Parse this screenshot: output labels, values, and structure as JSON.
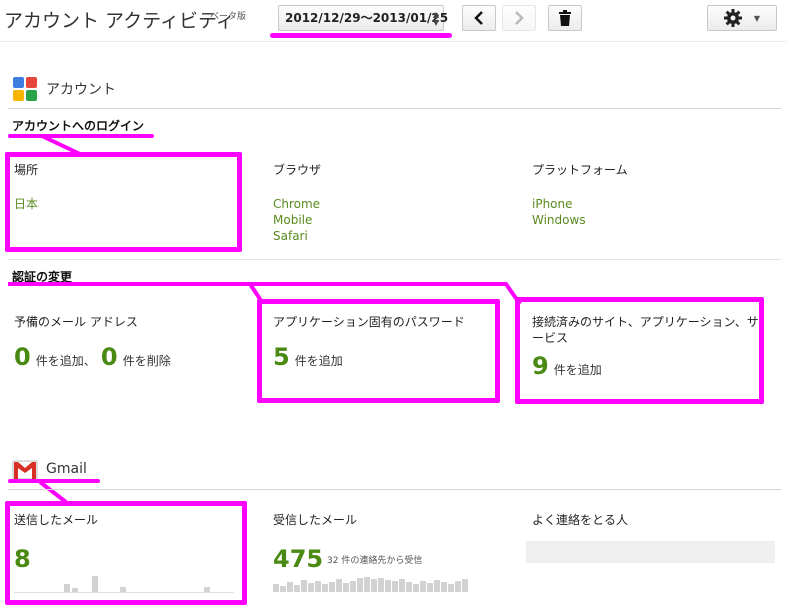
{
  "header": {
    "title": "アカウント アクティビティ",
    "beta": "ベータ版",
    "date_range": "2012/12/29〜2013/01/25",
    "prev_icon": "chevron-left-icon",
    "next_icon": "chevron-right-icon",
    "delete_icon": "trash-icon",
    "settings_icon": "gear-icon"
  },
  "account": {
    "section_title": "アカウント",
    "login": {
      "title": "アカウントへのログイン",
      "location_label": "場所",
      "locations": [
        "日本"
      ],
      "browser_label": "ブラウザ",
      "browsers": [
        "Chrome",
        "Mobile",
        "Safari"
      ],
      "platform_label": "プラットフォーム",
      "platforms": [
        "iPhone",
        "Windows"
      ]
    },
    "auth": {
      "title": "認証の変更",
      "backup_email_label": "予備のメール アドレス",
      "backup_added": "0",
      "backup_added_text": "件を追加、",
      "backup_removed": "0",
      "backup_removed_text": "件を削除",
      "app_password_label": "アプリケーション固有のパスワード",
      "app_password_count": "5",
      "app_password_text": "件を追加",
      "connected_label_1": "接続済みのサイト、アプリケーション、サ",
      "connected_label_2": "ービス",
      "connected_count": "9",
      "connected_text": "件を追加"
    }
  },
  "gmail": {
    "section_title": "Gmail",
    "sent_label": "送信したメール",
    "sent_count": "8",
    "received_label": "受信したメール",
    "received_count": "475",
    "received_note": "32 件の連絡先から受信",
    "frequent_label": "よく連絡をとる人"
  },
  "colors": {
    "highlight": "#ff00ff",
    "green": "#4a8a12",
    "link_green": "#5a8a1e"
  }
}
